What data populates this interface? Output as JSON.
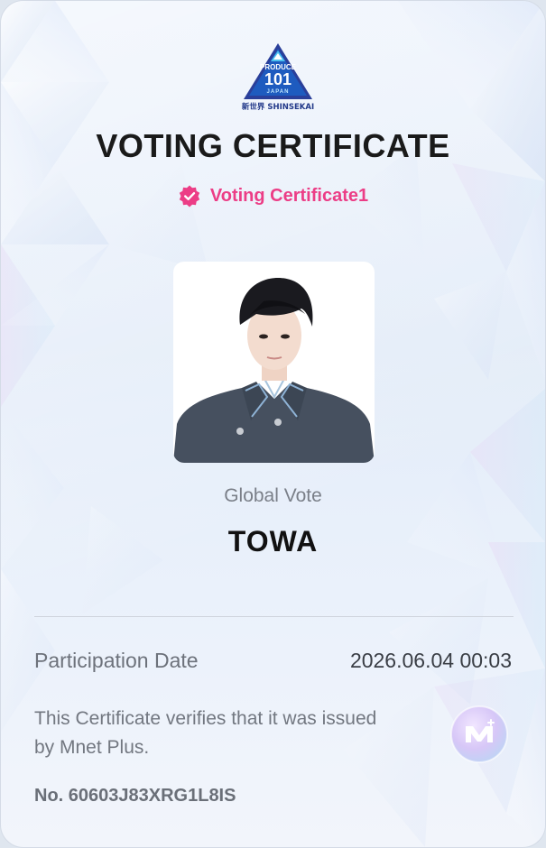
{
  "logo": {
    "line1": "PRODUCE",
    "line2": "101",
    "line3": "JAPAN",
    "line4": "新世界 SHINSEKAI",
    "icon": "produce101-logo"
  },
  "certificate": {
    "title": "VOTING CERTIFICATE",
    "badge_icon": "verified-badge-icon",
    "badge_label": "Voting Certificate1",
    "badge_color": "#ec3d86",
    "vote_type": "Global Vote",
    "name": "TOWA"
  },
  "details": {
    "date_label": "Participation Date",
    "date_value": "2026.06.04 00:03",
    "note": "This Certificate verifies that it was issued by Mnet Plus.",
    "serial": "No. 60603J83XRG1L8IS",
    "brand_icon": "mnet-plus-icon"
  }
}
